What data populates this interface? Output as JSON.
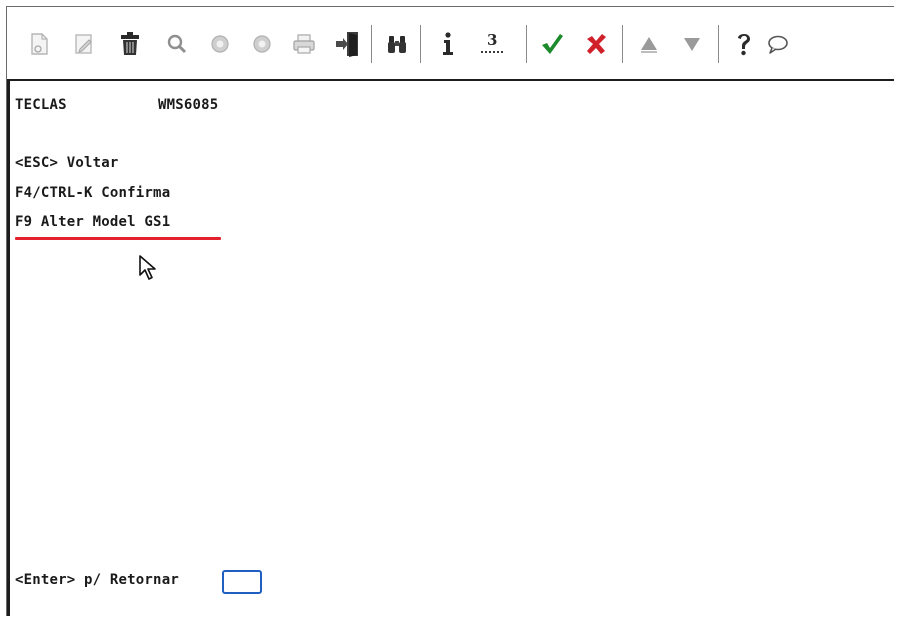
{
  "toolbar": {
    "buttons": [
      {
        "icon": "new-document-icon",
        "enabled": false
      },
      {
        "icon": "edit-icon",
        "enabled": false
      },
      {
        "icon": "trash-icon",
        "enabled": true
      },
      {
        "icon": "magnifier-icon",
        "enabled": false
      },
      {
        "icon": "circle-prev-icon",
        "enabled": false
      },
      {
        "icon": "circle-next-icon",
        "enabled": false
      },
      {
        "icon": "printer-icon",
        "enabled": false
      },
      {
        "icon": "exit-door-icon",
        "enabled": true
      },
      {
        "icon": "binoculars-icon",
        "enabled": true
      },
      {
        "icon": "info-icon",
        "enabled": true
      },
      {
        "icon": "counter-icon",
        "enabled": true
      },
      {
        "icon": "check-icon",
        "enabled": true
      },
      {
        "icon": "cancel-icon",
        "enabled": true
      },
      {
        "icon": "arrow-up-icon",
        "enabled": false
      },
      {
        "icon": "arrow-down-icon",
        "enabled": false
      },
      {
        "icon": "help-icon",
        "enabled": true
      },
      {
        "icon": "chat-icon",
        "enabled": true
      }
    ],
    "counter_label": "3"
  },
  "screen": {
    "header_left": "TECLAS",
    "header_right": "WMS6085",
    "lines": [
      "<ESC> Voltar",
      "F4/CTRL-K Confirma",
      "F9 Alter Model GS1"
    ],
    "prompt_label": "<Enter> p/ Retornar",
    "prompt_value": ""
  },
  "colors": {
    "underline": "#e4222d",
    "check": "#1a8a2a",
    "cancel": "#d0202a",
    "input_border": "#1f5fbf"
  }
}
